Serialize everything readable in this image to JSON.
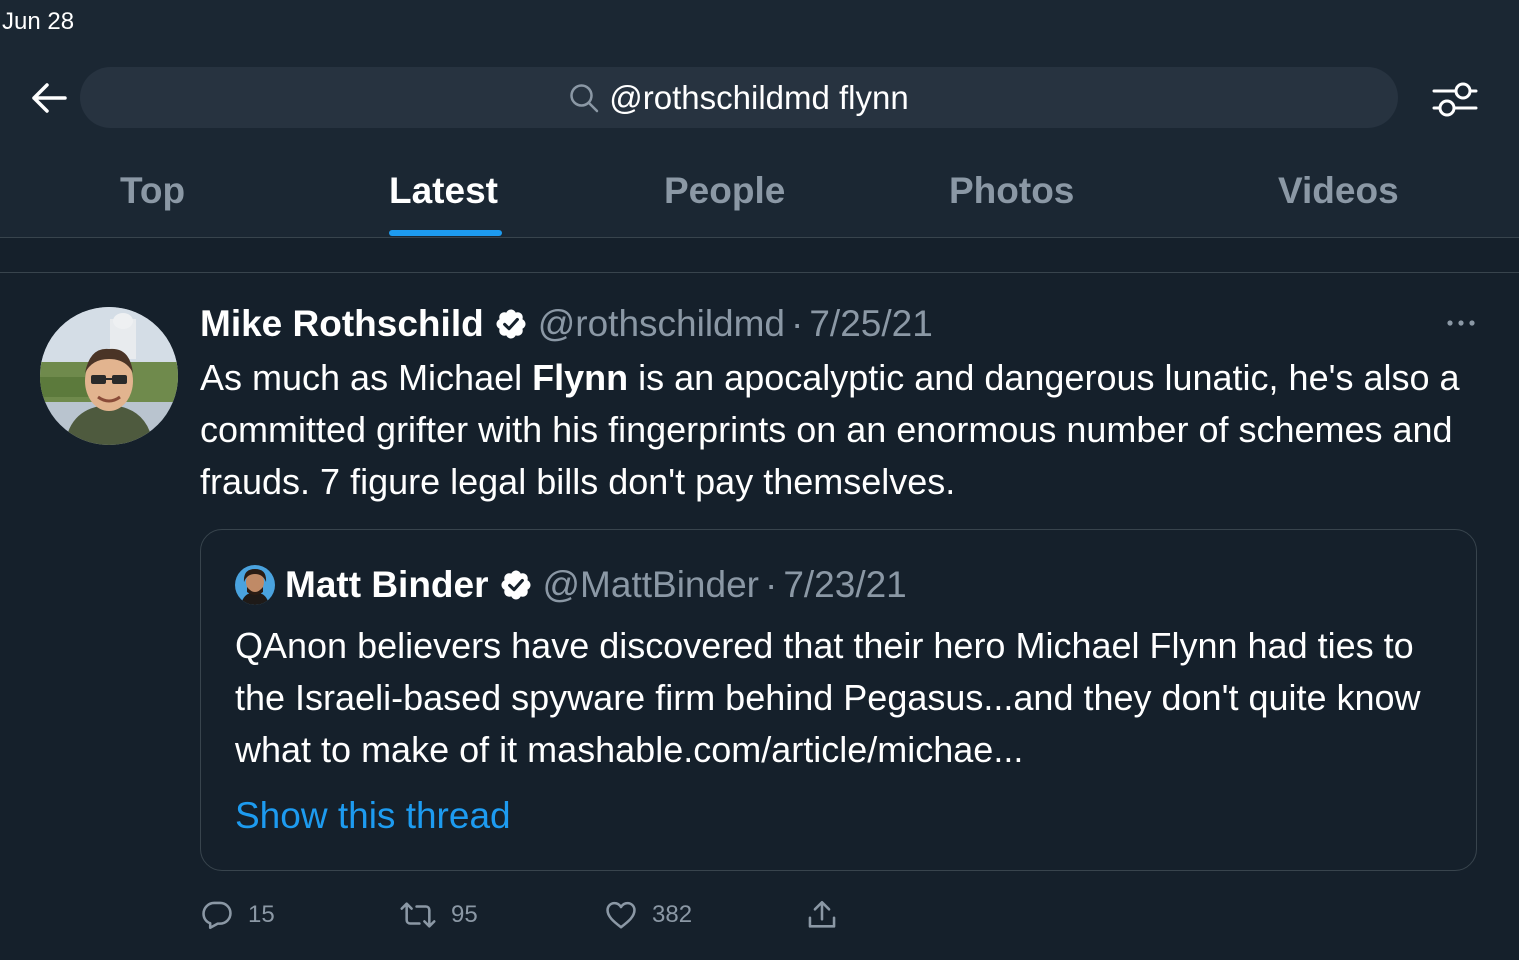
{
  "status_bar": {
    "time": "Jun 28"
  },
  "search": {
    "query": "@rothschildmd flynn"
  },
  "tabs": [
    {
      "label": "Top"
    },
    {
      "label": "Latest"
    },
    {
      "label": "People"
    },
    {
      "label": "Photos"
    },
    {
      "label": "Videos"
    }
  ],
  "active_tab": "Latest",
  "tweet": {
    "author": "Mike Rothschild",
    "handle": "@rothschildmd",
    "separator": "·",
    "date": "7/25/21",
    "text_before": "As much as Michael ",
    "text_highlight": "Flynn",
    "text_after": " is an apocalyptic and dangerous lunatic, he's also a committed grifter with his fingerprints on an enormous number of schemes and frauds. 7 figure legal bills don't pay themselves.",
    "quote": {
      "author": "Matt Binder",
      "handle": "@MattBinder",
      "separator": "·",
      "date": "7/23/21",
      "text": "QAnon believers have discovered that their hero Michael Flynn had ties to the Israeli-based spyware firm behind Pegasus...and they don't quite know what to make of it mashable.com/article/michae...",
      "thread_link": "Show this thread"
    },
    "actions": {
      "replies": "15",
      "retweets": "95",
      "likes": "382"
    }
  },
  "colors": {
    "background": "#15202b",
    "header_background": "#1b2733",
    "accent": "#1d9bf0",
    "secondary_text": "#8b98a5",
    "border": "#38444d"
  },
  "icons": [
    "back-arrow-icon",
    "search-icon",
    "filter-icon",
    "verified-badge-icon",
    "more-icon",
    "reply-icon",
    "retweet-icon",
    "like-icon",
    "share-icon"
  ]
}
